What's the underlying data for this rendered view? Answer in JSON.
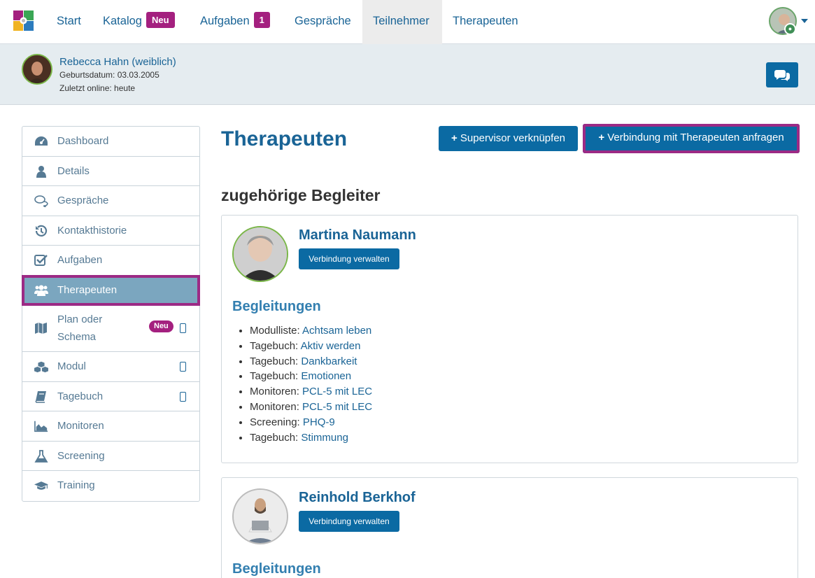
{
  "nav": {
    "items": [
      {
        "label": "Start"
      },
      {
        "label": "Katalog",
        "badge": "Neu"
      },
      {
        "label": "Aufgaben",
        "badge": "1"
      },
      {
        "label": "Gespräche"
      },
      {
        "label": "Teilnehmer",
        "active": true
      },
      {
        "label": "Therapeuten"
      }
    ]
  },
  "patient": {
    "name": "Rebecca Hahn (weiblich)",
    "dob": "Geburtsdatum: 03.03.2005",
    "online": "Zuletzt online: heute"
  },
  "sidebar": {
    "items": [
      {
        "label": "Dashboard",
        "icon": "dashboard-icon"
      },
      {
        "label": "Details",
        "icon": "user-icon"
      },
      {
        "label": "Gespräche",
        "icon": "chat-icon"
      },
      {
        "label": "Kontakthistorie",
        "icon": "history-icon"
      },
      {
        "label": "Aufgaben",
        "icon": "checkbox-icon"
      },
      {
        "label": "Therapeuten",
        "icon": "users-icon",
        "active": true
      },
      {
        "label": "Plan oder Schema",
        "icon": "map-icon",
        "badge": "Neu",
        "mobile": true
      },
      {
        "label": "Modul",
        "icon": "cubes-icon",
        "mobile": true
      },
      {
        "label": "Tagebuch",
        "icon": "book-icon",
        "mobile": true
      },
      {
        "label": "Monitoren",
        "icon": "area-chart-icon"
      },
      {
        "label": "Screening",
        "icon": "flask-icon"
      },
      {
        "label": "Training",
        "icon": "graduation-cap-icon"
      }
    ]
  },
  "main": {
    "title": "Therapeuten",
    "btn_supervisor": "Supervisor verknüpfen",
    "btn_request": "Verbindung mit Therapeuten anfragen",
    "section_title": "zugehörige Begleiter",
    "cards": [
      {
        "name": "Martina Naumann",
        "button": "Verbindung verwalten",
        "subtitle": "Begleitungen",
        "items": [
          {
            "type": "Modulliste:",
            "link": "Achtsam leben"
          },
          {
            "type": "Tagebuch:",
            "link": "Aktiv werden"
          },
          {
            "type": "Tagebuch:",
            "link": "Dankbarkeit"
          },
          {
            "type": "Tagebuch:",
            "link": "Emotionen"
          },
          {
            "type": "Monitoren:",
            "link": "PCL-5 mit LEC"
          },
          {
            "type": "Monitoren:",
            "link": "PCL-5 mit LEC"
          },
          {
            "type": "Screening:",
            "link": "PHQ-9"
          },
          {
            "type": "Tagebuch:",
            "link": "Stimmung"
          }
        ]
      },
      {
        "name": "Reinhold Berkhof",
        "button": "Verbindung verwalten",
        "subtitle": "Begleitungen"
      }
    ]
  },
  "colors": {
    "primary": "#0b6aa3",
    "link": "#1a6496",
    "badge": "#a4207f",
    "highlight": "#9c2a85",
    "sidebar_active": "#7ba6bf"
  }
}
